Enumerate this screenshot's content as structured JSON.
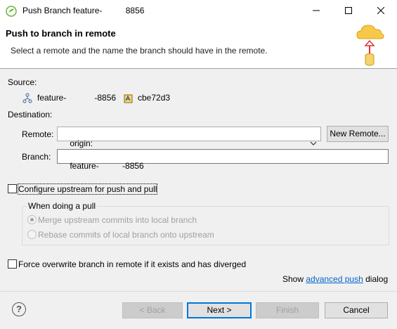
{
  "window": {
    "title": "Push Branch feature-          8856",
    "controls": {
      "minimize": "minimize-icon",
      "maximize": "maximize-icon",
      "close": "close-icon"
    }
  },
  "header": {
    "title": "Push to branch in remote",
    "description": "Select a remote and the name the branch should have in the remote."
  },
  "source": {
    "label": "Source:",
    "branch": "feature-            -8856",
    "commit": "cbe72d3"
  },
  "destination": {
    "label": "Destination:",
    "remote_label": "Remote:",
    "remote_value": "origin:",
    "new_remote_button": "New Remote...",
    "branch_label": "Branch:",
    "branch_value": "feature-          -8856"
  },
  "upstream": {
    "configure_label": "Configure upstream for push and pull",
    "configure_checked": false,
    "group_label": "When doing a pull",
    "merge_label": "Merge upstream commits into local branch",
    "rebase_label": "Rebase commits of local branch onto upstream"
  },
  "force": {
    "label": "Force overwrite branch in remote if it exists and has diverged",
    "checked": false
  },
  "advanced": {
    "prefix": "Show ",
    "link": "advanced push",
    "suffix": " dialog"
  },
  "buttons": {
    "back": "< Back",
    "next": "Next >",
    "finish": "Finish",
    "cancel": "Cancel",
    "help": "?"
  },
  "colors": {
    "accent": "#0078d7",
    "link": "#0066cc",
    "disabled_text": "#a0a0a0"
  }
}
